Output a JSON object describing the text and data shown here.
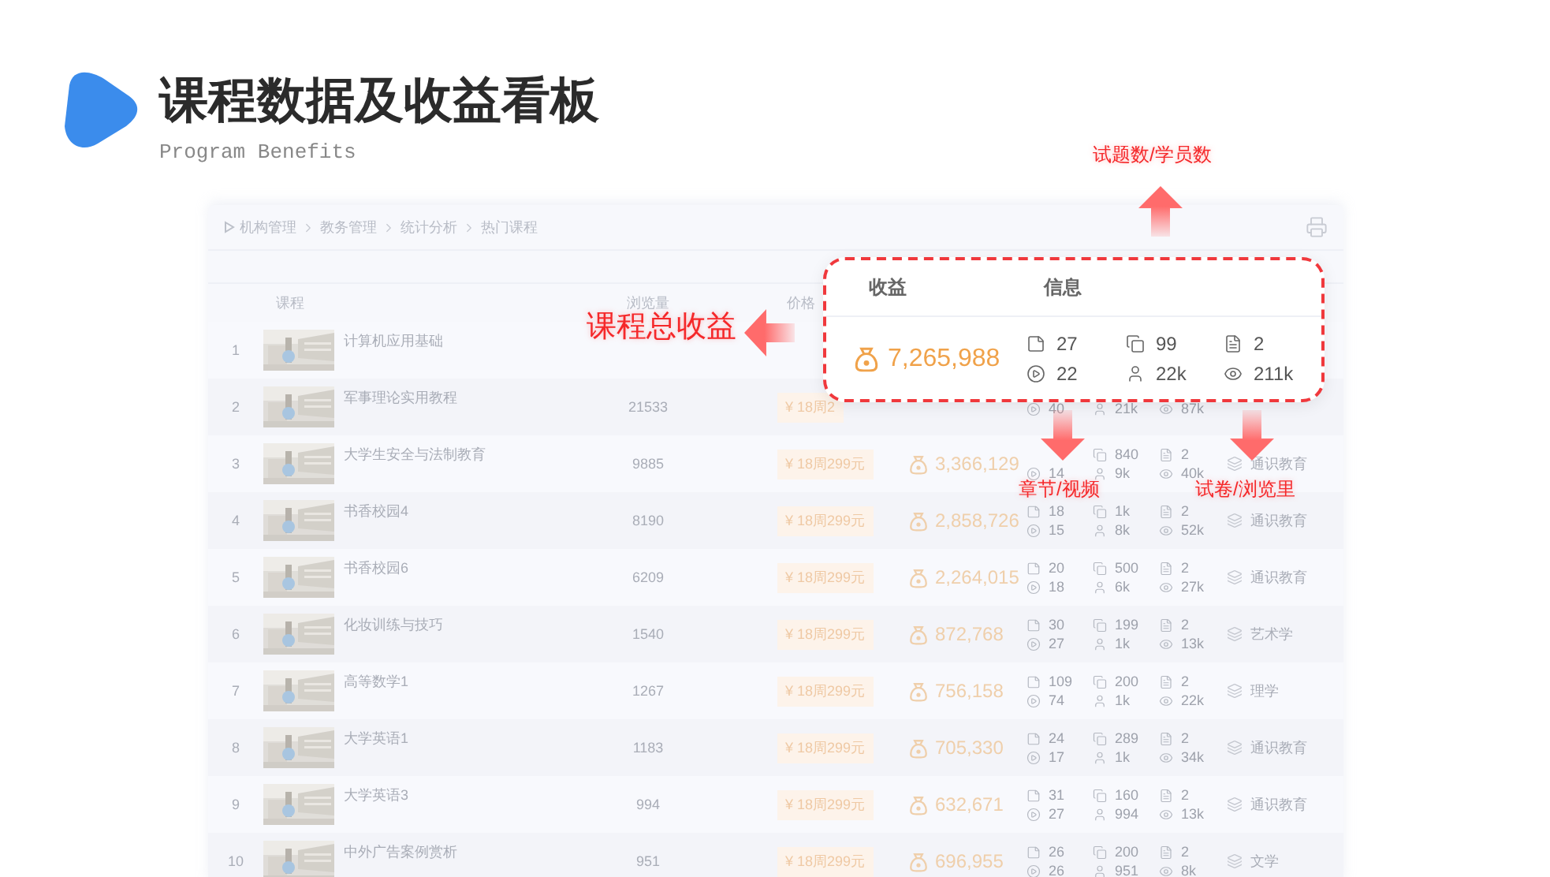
{
  "header": {
    "title": "课程数据及收益看板",
    "subtitle": "Program Benefits"
  },
  "panel": {
    "breadcrumb": [
      "机构管理",
      "教务管理",
      "统计分析",
      "热门课程"
    ],
    "columns": [
      "课程",
      "浏览量",
      "价格"
    ],
    "rows": [
      {
        "index": "1",
        "name": "计算机应用基础"
      },
      {
        "index": "2",
        "name": "军事理论实用教程",
        "views": "21533",
        "price": "¥ 18周2",
        "videos": "40",
        "students": "21k",
        "page_views": "87k"
      },
      {
        "index": "3",
        "name": "大学生安全与法制教育",
        "views": "9885",
        "price": "¥ 18周299元",
        "revenue": "3,366,129",
        "videos": "14",
        "materials": "840",
        "students": "9k",
        "papers": "2",
        "page_views": "40k",
        "category": "通识教育"
      },
      {
        "index": "4",
        "name": "书香校园4",
        "views": "8190",
        "price": "¥ 18周299元",
        "revenue": "2,858,726",
        "chapters": "18",
        "videos": "15",
        "materials": "1k",
        "students": "8k",
        "papers": "2",
        "page_views": "52k",
        "category": "通识教育"
      },
      {
        "index": "5",
        "name": "书香校园6",
        "views": "6209",
        "price": "¥ 18周299元",
        "revenue": "2,264,015",
        "chapters": "20",
        "videos": "18",
        "materials": "500",
        "students": "6k",
        "papers": "2",
        "page_views": "27k",
        "category": "通识教育"
      },
      {
        "index": "6",
        "name": "化妆训练与技巧",
        "views": "1540",
        "price": "¥ 18周299元",
        "revenue": "872,768",
        "chapters": "30",
        "videos": "27",
        "materials": "199",
        "students": "1k",
        "papers": "2",
        "page_views": "13k",
        "category": "艺术学"
      },
      {
        "index": "7",
        "name": "高等数学1",
        "views": "1267",
        "price": "¥ 18周299元",
        "revenue": "756,158",
        "chapters": "109",
        "videos": "74",
        "materials": "200",
        "students": "1k",
        "papers": "2",
        "page_views": "22k",
        "category": "理学"
      },
      {
        "index": "8",
        "name": "大学英语1",
        "views": "1183",
        "price": "¥ 18周299元",
        "revenue": "705,330",
        "chapters": "24",
        "videos": "17",
        "materials": "289",
        "students": "1k",
        "papers": "2",
        "page_views": "34k",
        "category": "通识教育"
      },
      {
        "index": "9",
        "name": "大学英语3",
        "views": "994",
        "price": "¥ 18周299元",
        "revenue": "632,671",
        "chapters": "31",
        "videos": "27",
        "materials": "160",
        "students": "994",
        "papers": "2",
        "page_views": "13k",
        "category": "通识教育"
      },
      {
        "index": "10",
        "name": "中外广告案例赏析",
        "views": "951",
        "price": "¥ 18周299元",
        "revenue": "696,955",
        "chapters": "26",
        "videos": "26",
        "materials": "200",
        "students": "951",
        "papers": "2",
        "page_views": "8k",
        "category": "文学"
      }
    ]
  },
  "popup": {
    "columns": [
      "收益",
      "信息"
    ],
    "revenue": "7,265,988",
    "chapters": "27",
    "materials": "99",
    "papers": "2",
    "videos": "22",
    "students": "22k",
    "page_views": "211k"
  },
  "annotations": [
    {
      "text": "试题数/学员数"
    },
    {
      "text": "课程总收益"
    },
    {
      "text": "章节/视频"
    },
    {
      "text": "试卷/浏览里"
    }
  ]
}
